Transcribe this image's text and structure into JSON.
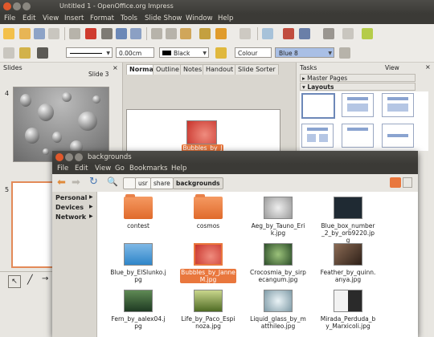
{
  "impress": {
    "title": "Untitled 1 - OpenOffice.org Impress",
    "menu": [
      "File",
      "Edit",
      "View",
      "Insert",
      "Format",
      "Tools",
      "Slide Show",
      "Window",
      "Help"
    ],
    "line_width": "0.00cm",
    "line_color": "Black",
    "fill_mode": "Colour",
    "fill_color": "Blue 8",
    "slides_label": "Slides",
    "slide_caption": "Slide 3",
    "slide_numbers": [
      "4",
      "5"
    ],
    "view_tabs": [
      "Normal",
      "Outline",
      "Notes",
      "Handout",
      "Slide Sorter"
    ],
    "tasks_label": "Tasks",
    "tasks_view": "View",
    "master_pages": "Master Pages",
    "layouts": "Layouts"
  },
  "drag": {
    "label": "Bubbles_by_JanneM.jpg"
  },
  "nautilus": {
    "title": "backgrounds",
    "menu": [
      "File",
      "Edit",
      "View",
      "Go",
      "Bookmarks",
      "Help"
    ],
    "crumbs": [
      "usr",
      "share",
      "backgrounds"
    ],
    "sidebar": [
      "Personal",
      "Devices",
      "Network"
    ],
    "files": [
      {
        "name": "contest",
        "kind": "folder"
      },
      {
        "name": "cosmos",
        "kind": "folder"
      },
      {
        "name": "Aeg_by_Tauno_Erik.jpg",
        "kind": "photo",
        "color": "#cfcfcf"
      },
      {
        "name": "Blue_box_number_2_by_orb9220.jpg",
        "kind": "photo",
        "color": "#1f2a33"
      },
      {
        "name": "Blue_by_ElSlunko.jpg",
        "kind": "photo",
        "color": "#2f86c9"
      },
      {
        "name": "Bubbles_by_JanneM.jpg",
        "kind": "photo",
        "color": "#c8322a",
        "selected": true
      },
      {
        "name": "Crocosmia_by_sirpecangum.jpg",
        "kind": "photo",
        "color": "#3d6e3a"
      },
      {
        "name": "Feather_by_quinn.anya.jpg",
        "kind": "photo",
        "color": "#5a4032"
      },
      {
        "name": "Fern_by_aalex04.jpg",
        "kind": "photo",
        "color": "#2e5a35"
      },
      {
        "name": "Life_by_Paco_Espinoza.jpg",
        "kind": "photo",
        "color": "#6f8b2e"
      },
      {
        "name": "Liquid_glass_by_matthileo.jpg",
        "kind": "photo",
        "color": "#a9c0c9"
      },
      {
        "name": "Mirada_Perduda_by_Marxicoli.jpg",
        "kind": "photo",
        "color": "#d8d8d8"
      }
    ]
  },
  "colors": {
    "accent": "#e9773d",
    "titlebar": "#3b3a36"
  }
}
